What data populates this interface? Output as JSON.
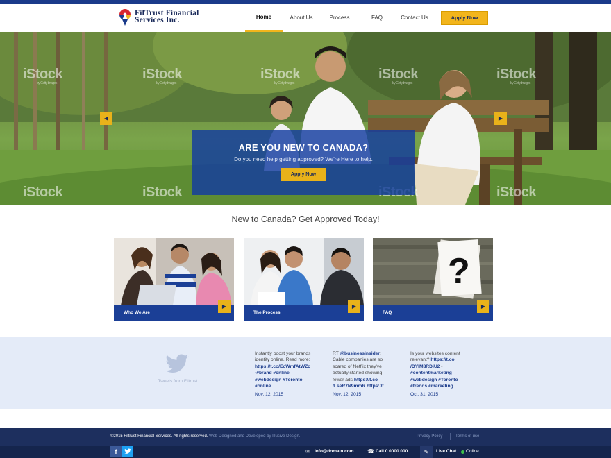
{
  "header": {
    "logo_line1": "FilTrust Financial",
    "logo_line2": "Services Inc.",
    "nav": [
      "Home",
      "About Us",
      "Process",
      "FAQ",
      "Contact Us"
    ],
    "active_nav": "Home",
    "apply_label": "Apply Now"
  },
  "colors": {
    "navy": "#1a3a8a",
    "accent_yellow": "#f2b51c",
    "card_bar": "#1b3f96",
    "footer": "#1d2f5e",
    "tweets_bg": "#e4ebf8"
  },
  "hero": {
    "watermark": "iStock",
    "watermark_sub": "by Getty Images",
    "title": "ARE YOU NEW TO CANADA?",
    "subtitle": "Do you need help getting approved? We're Here to help.",
    "button": "Apply Now",
    "prev_icon": "chevron-left-icon",
    "next_icon": "chevron-right-icon"
  },
  "tagline": "New to Canada? Get Approved Today!",
  "cards": [
    {
      "label": "Who We Are",
      "icon": "chevron-right-icon"
    },
    {
      "label": "The Process",
      "icon": "chevron-right-icon"
    },
    {
      "label": "FAQ",
      "icon": "chevron-right-icon"
    }
  ],
  "tweets": {
    "widget_label": "Tweets from Filtrust",
    "widget_icon": "twitter-bird-icon",
    "items": [
      {
        "lines": [
          "Instantly boost your brands",
          "identity online. Read more:"
        ],
        "links": [
          "https://t.co/EcWmfAtWZc",
          "-#brand #online",
          "#webdesign #Toronto",
          "#online"
        ],
        "date": "Nov. 12, 2015"
      },
      {
        "prefix": "RT ",
        "handle": "@businessinsider",
        "lines": [
          "Cable companies are so",
          "scared of Netflix they've",
          "actually started showing",
          "fewer ads"
        ],
        "links": [
          "https://t.co",
          "/LseR7N9mmR",
          "https://t...."
        ],
        "date": "Nov. 12, 2015"
      },
      {
        "lines": [
          "Is your websites content",
          "relevant?"
        ],
        "links": [
          "https://t.co",
          "/DYIM8RDiU2",
          "#contentmarketing",
          "#webdesign #Toronto",
          "#trends #marketing"
        ],
        "date": "Oct. 31, 2015"
      }
    ]
  },
  "footer": {
    "copyright": "©2015 Filtrust Financial Services. All rights reserved.",
    "credit": "Web Designed and Developed by Illusive Design.",
    "privacy": "Privacy Policy",
    "terms": "Terms of use"
  },
  "bottom_bar": {
    "social": [
      {
        "icon": "facebook-icon",
        "glyph": "f"
      },
      {
        "icon": "twitter-icon",
        "glyph": "t"
      }
    ],
    "email": "info@domain.com",
    "phone": "Call 0.0000.000",
    "chat": "Live Chat",
    "status": "Online"
  }
}
